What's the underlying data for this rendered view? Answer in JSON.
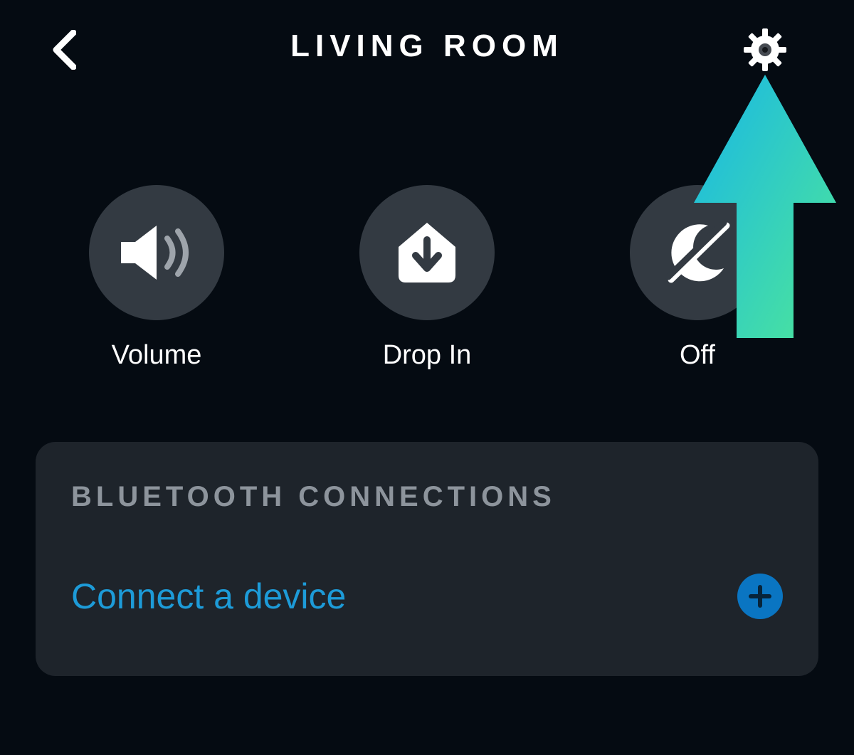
{
  "header": {
    "title": "LIVING ROOM"
  },
  "actions": {
    "volume_label": "Volume",
    "dropin_label": "Drop In",
    "dnd_label": "Off"
  },
  "bluetooth": {
    "section_title": "BLUETOOTH CONNECTIONS",
    "connect_label": "Connect a device"
  },
  "colors": {
    "accent_link": "#1d9bd8",
    "plus_bg": "#0a75c2",
    "card_bg": "#1e242b",
    "action_bg": "#333a42"
  }
}
